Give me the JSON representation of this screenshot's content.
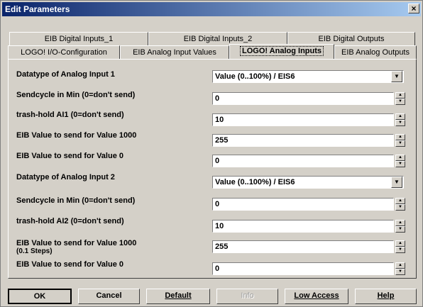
{
  "window": {
    "title": "Edit Parameters",
    "close": "×"
  },
  "tabs_back": [
    {
      "label": "EIB Digital Inputs_1"
    },
    {
      "label": "EIB Digital Inputs_2"
    },
    {
      "label": "EIB Digital Outputs"
    }
  ],
  "tabs_front": [
    {
      "label": "LOGO! I/O-Configuration"
    },
    {
      "label": "EIB Analog Input Values"
    },
    {
      "label": "LOGO! Analog Inputs"
    },
    {
      "label": "EIB Analog Outputs"
    }
  ],
  "active_tab": "LOGO! Analog Inputs",
  "params": [
    {
      "label": "Datatype of Analog Input 1",
      "value": "Value (0..100%) / EIS6",
      "kind": "dropdown"
    },
    {
      "label": "Sendcycle in Min (0=don't send)",
      "value": "0",
      "kind": "spin"
    },
    {
      "label": " trash-hold  AI1 (0=don't send)",
      "value": "10",
      "kind": "spin"
    },
    {
      "label": "EIB Value to send for Value 1000",
      "value": "255",
      "kind": "spin"
    },
    {
      "label": "EIB Value to send for Value  0",
      "value": "0",
      "kind": "spin"
    },
    {
      "label": "Datatype of Analog Input 2",
      "value": "Value (0..100%) / EIS6",
      "kind": "dropdown"
    },
    {
      "label": "Sendcycle in Min (0=don't send)",
      "value": "0",
      "kind": "spin"
    },
    {
      "label": " trash-hold  AI2 (0=don't send)",
      "value": "10",
      "kind": "spin"
    },
    {
      "label": "EIB Value to send for Value  1000",
      "sublabel": "(0.1 Steps)",
      "value": "255",
      "kind": "spin"
    },
    {
      "label": "EIB Value to send for Value  0",
      "value": "0",
      "kind": "spin"
    }
  ],
  "buttons": {
    "ok": "OK",
    "cancel": "Cancel",
    "default": "Default",
    "info": "Info",
    "low_access": "Low Access",
    "help": "Help"
  },
  "colors": {
    "titlebar_start": "#0a246a",
    "titlebar_end": "#a6caf0",
    "face": "#d4d0c8"
  }
}
